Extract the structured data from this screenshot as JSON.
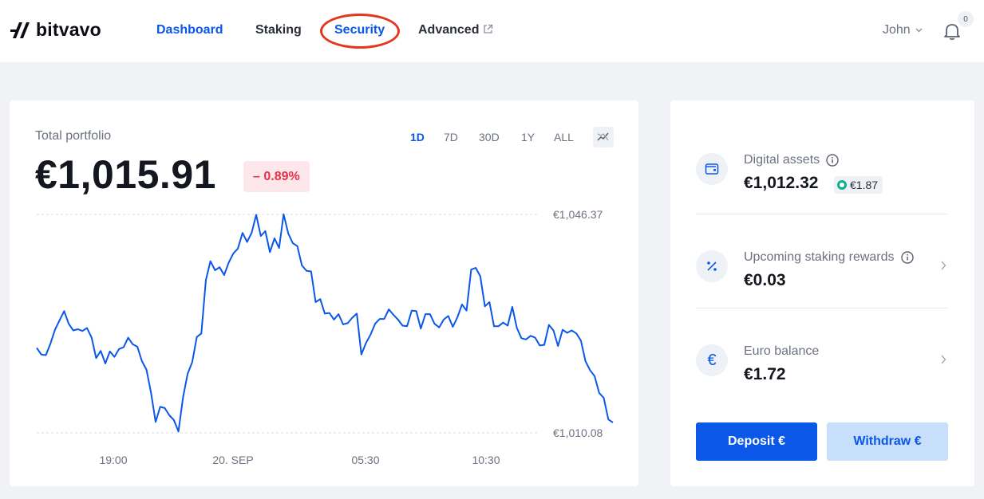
{
  "brand": {
    "name": "bitvavo"
  },
  "nav": {
    "items": [
      {
        "label": "Dashboard",
        "active": true
      },
      {
        "label": "Staking",
        "active": false
      },
      {
        "label": "Security",
        "active": false,
        "highlighted": true
      },
      {
        "label": "Advanced",
        "active": false,
        "external": true
      }
    ]
  },
  "user": {
    "name": "John",
    "notifications": "0"
  },
  "portfolio": {
    "label": "Total portfolio",
    "value": "€1,015.91",
    "change": "– 0.89%",
    "ranges": [
      "1D",
      "7D",
      "30D",
      "1Y",
      "ALL"
    ],
    "active_range": "1D"
  },
  "balances": {
    "digital_assets": {
      "label": "Digital assets",
      "value": "€1,012.32",
      "staked": "€1.87"
    },
    "staking_rewards": {
      "label": "Upcoming staking rewards",
      "value": "€0.03"
    },
    "euro_balance": {
      "label": "Euro balance",
      "value": "€1.72"
    }
  },
  "actions": {
    "deposit": "Deposit €",
    "withdraw": "Withdraw €"
  },
  "colors": {
    "accent": "#0a57e8",
    "negative": "#e5304a",
    "staked": "#0fae8c",
    "highlight_ring": "#e4361f"
  },
  "chart_data": {
    "type": "line",
    "x_ticks": [
      "19:00",
      "20. SEP",
      "05:30",
      "10:30"
    ],
    "y_labels": [
      "€1,046.37",
      "€1,010.08"
    ],
    "ylim": [
      1010.08,
      1046.37
    ],
    "grid": true,
    "series": [
      {
        "values": [
          1024.2,
          1023.1,
          1023.0,
          1024.9,
          1027.2,
          1028.8,
          1030.3,
          1028.2,
          1027.1,
          1027.3,
          1027.0,
          1027.5,
          1025.9,
          1022.5,
          1023.7,
          1021.6,
          1023.6,
          1022.7,
          1024.0,
          1024.3,
          1025.9,
          1024.8,
          1024.4,
          1022.0,
          1020.6,
          1016.7,
          1011.9,
          1014.4,
          1014.2,
          1013.0,
          1012.2,
          1010.3,
          1016.0,
          1019.9,
          1021.8,
          1026.0,
          1026.6,
          1035.5,
          1038.6,
          1037.1,
          1037.6,
          1036.3,
          1038.4,
          1039.9,
          1040.7,
          1043.3,
          1041.8,
          1043.3,
          1046.3,
          1042.8,
          1043.6,
          1040.1,
          1042.4,
          1040.8,
          1046.4,
          1043.2,
          1041.6,
          1041.1,
          1037.9,
          1037.0,
          1036.9,
          1031.8,
          1032.3,
          1029.9,
          1030.0,
          1028.9,
          1029.8,
          1028.1,
          1028.3,
          1029.2,
          1029.9,
          1023.1,
          1025.0,
          1026.4,
          1028.2,
          1029.0,
          1029.0,
          1030.6,
          1029.7,
          1028.9,
          1027.9,
          1027.8,
          1030.4,
          1030.3,
          1027.4,
          1029.8,
          1029.8,
          1028.2,
          1027.6,
          1028.9,
          1029.5,
          1027.7,
          1029.3,
          1031.4,
          1030.4,
          1037.2,
          1037.5,
          1036.1,
          1031.1,
          1031.8,
          1027.8,
          1027.8,
          1028.4,
          1027.9,
          1031.0,
          1027.5,
          1025.8,
          1025.6,
          1026.2,
          1025.9,
          1024.6,
          1024.7,
          1028.0,
          1027.1,
          1024.5,
          1027.2,
          1026.7,
          1027.1,
          1026.6,
          1025.4,
          1022.0,
          1020.5,
          1019.5,
          1016.7,
          1015.9,
          1012.3,
          1011.8
        ]
      }
    ]
  }
}
